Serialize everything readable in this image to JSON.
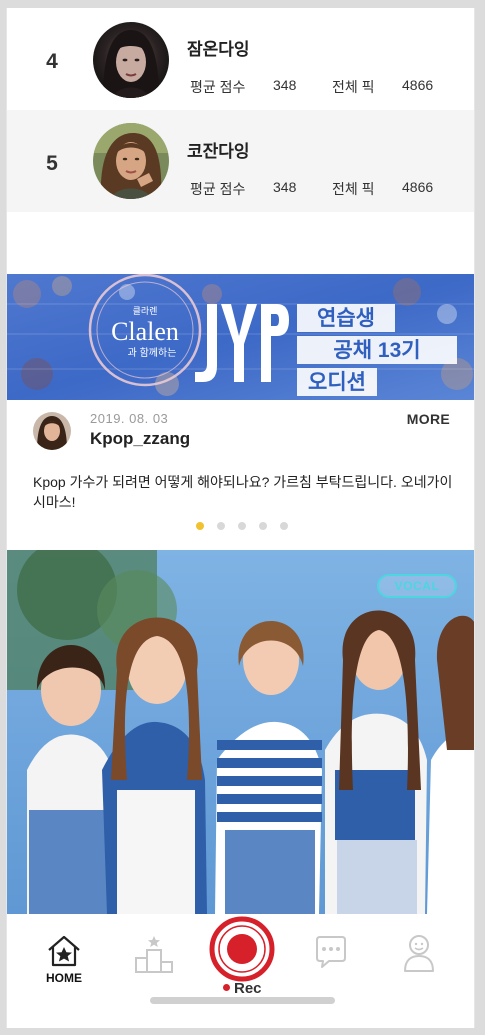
{
  "rankings": [
    {
      "rank": "4",
      "name": "잠온다잉",
      "avg_label": "평균 점수",
      "avg_value": "348",
      "total_label": "전체 픽",
      "total_value": "4866"
    },
    {
      "rank": "5",
      "name": "코잔다잉",
      "avg_label": "평균 점수",
      "avg_value": "348",
      "total_label": "전체 픽",
      "total_value": "4866"
    }
  ],
  "banner": {
    "brand_small": "클라렌",
    "brand": "Clalen",
    "with_text": "과 함께하는",
    "logo": "JYP",
    "line1": "연습생",
    "line2": "공채 13기",
    "line3": "오디션"
  },
  "post": {
    "date": "2019. 08. 03",
    "username": "Kpop_zzang",
    "more_label": "MORE",
    "text": "Kpop 가수가 되려면 어떻게 해야되나요? 가르침 부탁드립니다. 오네가이시마스!"
  },
  "carousel": {
    "count": 5,
    "active_index": 0
  },
  "photo_badge": "VOCAL",
  "tabbar": {
    "home_label": "HOME",
    "rec_label": "Rec",
    "tabs": [
      "home-icon",
      "ranking-icon",
      "record-icon",
      "chat-icon",
      "profile-icon"
    ]
  },
  "colors": {
    "accent_yellow": "#f1c230",
    "rec_red": "#d6202a",
    "badge_cyan": "#4dd6e0",
    "banner_blue": "#3d69c7"
  }
}
